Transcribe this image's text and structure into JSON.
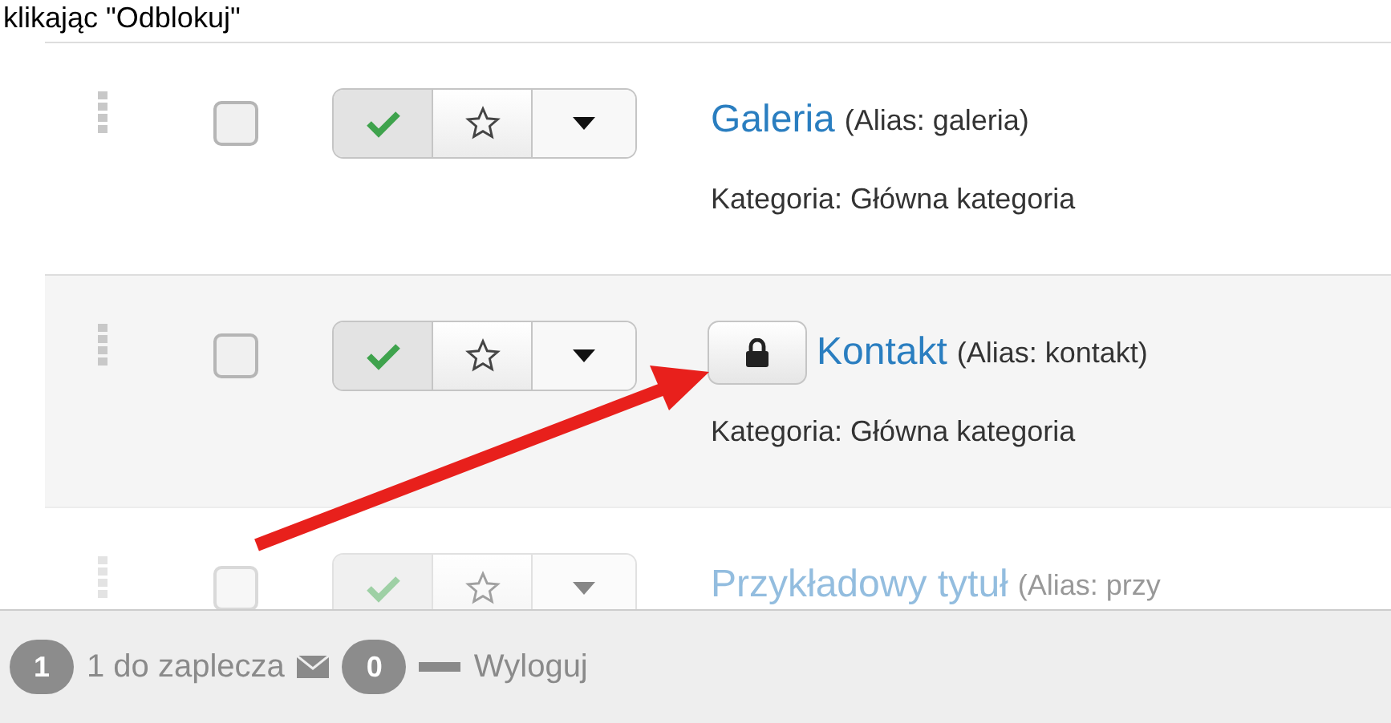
{
  "header_text": "klikając \"Odblokuj\"",
  "articles": [
    {
      "title": "Galeria",
      "alias": "(Alias: galeria)",
      "category": "Kategoria: Główna kategoria",
      "checked": false,
      "published": true,
      "featured": false,
      "locked": false,
      "faded": false
    },
    {
      "title": "Kontakt",
      "alias": "(Alias: kontakt)",
      "category": "Kategoria: Główna kategoria",
      "checked": false,
      "published": true,
      "featured": false,
      "locked": true,
      "faded": false
    },
    {
      "title": "Przykładowy tytuł",
      "alias": "(Alias: przy",
      "checked": false,
      "published": true,
      "featured": false,
      "locked": false,
      "faded": true
    }
  ],
  "annotation": {
    "kind": "arrow"
  },
  "status_bar": {
    "admin_count": "1",
    "admin_label": "1 do zaplecza",
    "messages_count": "0",
    "logout": "Wyloguj"
  }
}
